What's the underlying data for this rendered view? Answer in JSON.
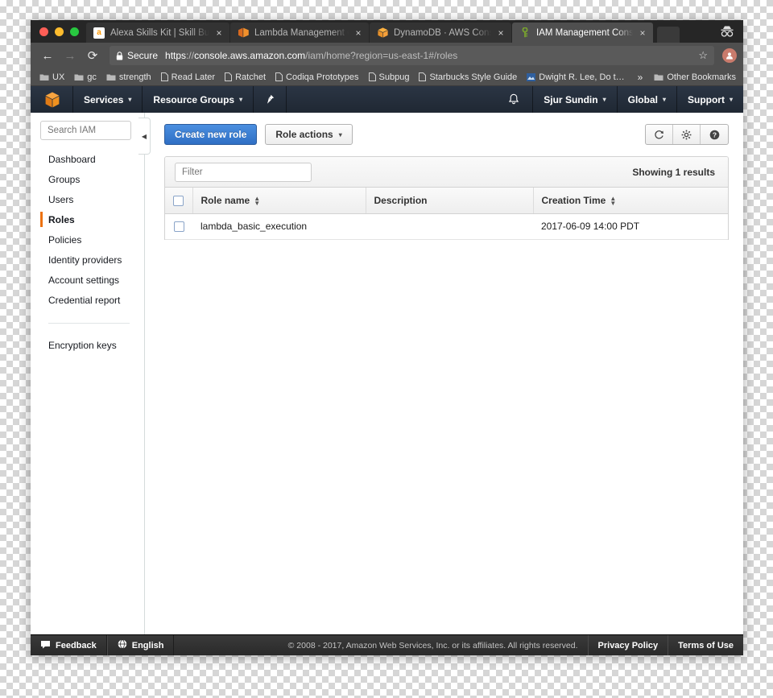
{
  "browser": {
    "tabs": [
      {
        "title": "Alexa Skills Kit | Skill Builder B",
        "favicon": "amazon-favicon",
        "close_label": "×",
        "active": false
      },
      {
        "title": "Lambda Management Console",
        "favicon": "lambda-favicon",
        "close_label": "×",
        "active": false
      },
      {
        "title": "DynamoDB · AWS Console",
        "favicon": "dynamodb-favicon",
        "close_label": "×",
        "active": false
      },
      {
        "title": "IAM Management Console",
        "favicon": "iam-key-favicon",
        "close_label": "×",
        "active": true
      }
    ],
    "toolbar": {
      "back_icon": "←",
      "forward_icon": "→",
      "reload_icon": "⟳",
      "secure_label": "Secure",
      "url_scheme": "https",
      "url_separator": "://",
      "url_host": "console.aws.amazon.com",
      "url_path": "/iam/home?region=us-east-1#/roles",
      "star_icon": "☆"
    },
    "bookmarks": [
      {
        "label": "UX",
        "icon": "folder-icon"
      },
      {
        "label": "gc",
        "icon": "folder-icon"
      },
      {
        "label": "strength",
        "icon": "folder-icon"
      },
      {
        "label": "Read Later",
        "icon": "page-icon"
      },
      {
        "label": "Ratchet",
        "icon": "page-icon"
      },
      {
        "label": "Codiqa Prototypes",
        "icon": "page-icon"
      },
      {
        "label": "Subpug",
        "icon": "page-icon"
      },
      {
        "label": "Starbucks Style Guide",
        "icon": "page-icon"
      },
      {
        "label": "Dwight R. Lee, Do t…",
        "icon": "image-favicon"
      }
    ],
    "bookmarks_overflow": "»",
    "other_bookmarks": {
      "label": "Other Bookmarks",
      "icon": "folder-icon"
    }
  },
  "aws_nav": {
    "logo": "aws-cube-logo",
    "services_label": "Services",
    "resource_groups_label": "Resource Groups",
    "pin_icon": "pin-icon",
    "bell_icon": "bell-icon",
    "account_label": "Sjur Sundin",
    "region_label": "Global",
    "support_label": "Support",
    "caret": "▾"
  },
  "sidebar": {
    "search_placeholder": "Search IAM",
    "search_value": "",
    "collapse_icon": "◀",
    "items": [
      {
        "label": "Dashboard",
        "active": false
      },
      {
        "label": "Groups",
        "active": false
      },
      {
        "label": "Users",
        "active": false
      },
      {
        "label": "Roles",
        "active": true
      },
      {
        "label": "Policies",
        "active": false
      },
      {
        "label": "Identity providers",
        "active": false
      },
      {
        "label": "Account settings",
        "active": false
      },
      {
        "label": "Credential report",
        "active": false
      }
    ],
    "secondary_items": [
      {
        "label": "Encryption keys"
      }
    ]
  },
  "main": {
    "create_button": "Create new role",
    "role_actions_button": "Role actions",
    "role_actions_caret": "▾",
    "icon_buttons": [
      {
        "name": "refresh-button",
        "glyph": "↻"
      },
      {
        "name": "settings-button",
        "glyph": "⚙"
      },
      {
        "name": "help-button",
        "glyph": "?"
      }
    ],
    "filter_placeholder": "Filter",
    "filter_value": "",
    "showing_results": "Showing 1 results",
    "table": {
      "columns": [
        {
          "label": "Role name",
          "sortable": true
        },
        {
          "label": "Description",
          "sortable": false
        },
        {
          "label": "Creation Time",
          "sortable": true
        }
      ],
      "sort_glyph": "⬍",
      "rows": [
        {
          "selected": false,
          "role_name": "lambda_basic_execution",
          "description": "",
          "creation_time": "2017-06-09 14:00 PDT"
        }
      ]
    }
  },
  "footer": {
    "feedback_label": "Feedback",
    "feedback_icon": "speech-bubble-icon",
    "language_label": "English",
    "language_icon": "globe-icon",
    "copyright": "© 2008 - 2017, Amazon Web Services, Inc. or its affiliates. All rights reserved.",
    "privacy_policy": "Privacy Policy",
    "terms_of_use": "Terms of Use"
  },
  "colors": {
    "aws_orange": "#ec7211",
    "aws_navy": "#232f3e",
    "primary_button": "#2f6fc4",
    "browser_chrome": "#4f4f4f"
  }
}
